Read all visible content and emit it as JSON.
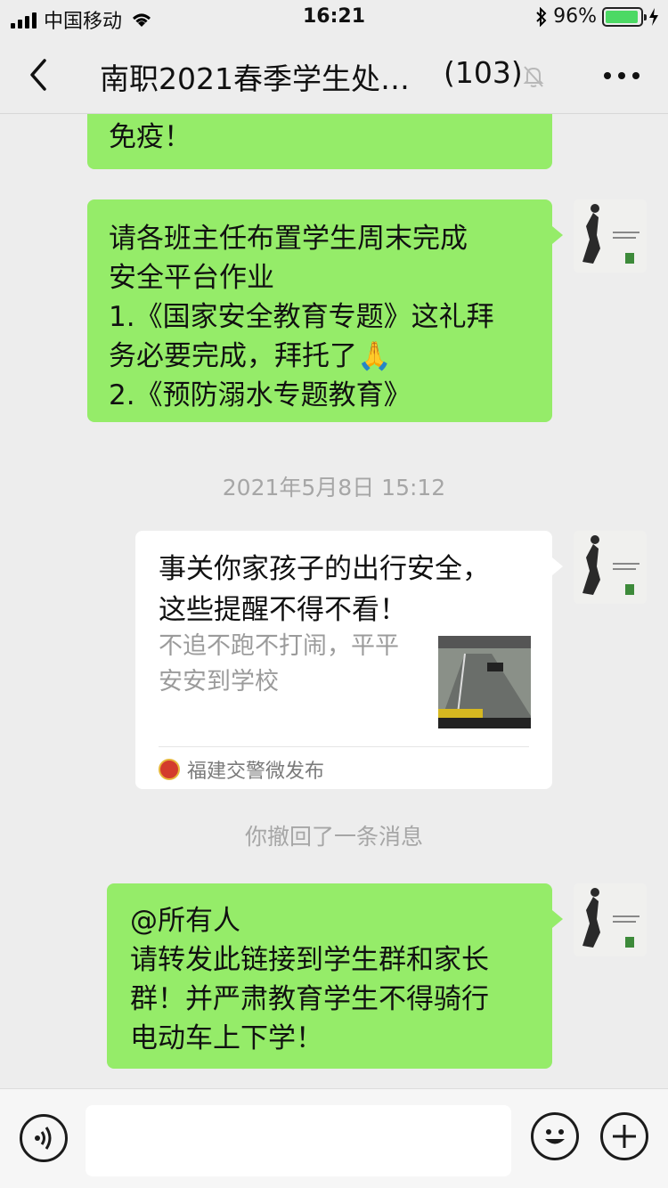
{
  "status_bar": {
    "carrier": "中国移动",
    "time": "16:21",
    "battery": "96%",
    "battery_level": 0.96
  },
  "nav": {
    "title": "南职2021春季学生处…",
    "member_count": "(103)"
  },
  "messages": [
    {
      "type": "text",
      "text": "免疫！"
    },
    {
      "type": "text",
      "lines": [
        "请各班主任布置学生周末完成",
        "安全平台作业",
        "1.《国家安全教育专题》这礼拜",
        "务必要完成，拜托了",
        "2.《预防溺水专题教育》"
      ],
      "emoji": "🙏"
    },
    {
      "type": "timestamp",
      "text": "2021年5月8日 15:12"
    },
    {
      "type": "link_card",
      "title_lines": [
        "事关你家孩子的出行安全，",
        "这些提醒不得不看！"
      ],
      "desc_lines": [
        "不追不跑不打闹，平平",
        "安安到学校"
      ],
      "source": "福建交警微发布"
    },
    {
      "type": "system",
      "text": "你撤回了一条消息"
    },
    {
      "type": "text",
      "lines": [
        "@所有人",
        "请转发此链接到学生群和家长",
        "群！并严肃教育学生不得骑行",
        "电动车上下学！"
      ]
    }
  ],
  "colors": {
    "bubble_green": "#95ec69",
    "background": "#ededed"
  }
}
